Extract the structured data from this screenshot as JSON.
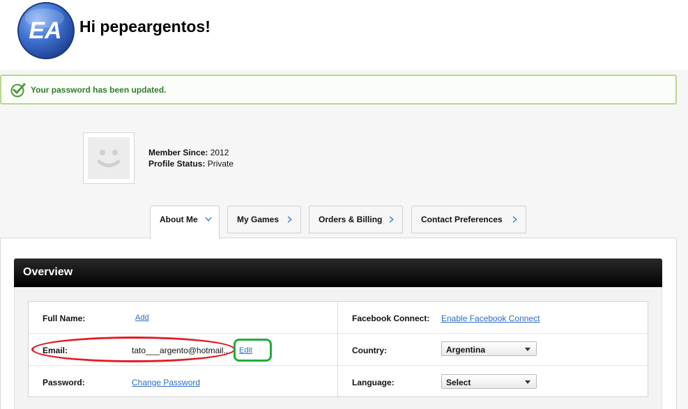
{
  "header": {
    "greeting": "Hi pepeargentos!",
    "logo_text": "EA"
  },
  "notice": {
    "message": "Your password has been updated.",
    "icon": "check-circle-icon",
    "color": "#2e7d32"
  },
  "profile": {
    "member_since_label": "Member Since:",
    "member_since_value": "2012",
    "profile_status_label": "Profile Status:",
    "profile_status_value": "Private"
  },
  "tabs": [
    {
      "label": "About Me",
      "icon": "chevron-down-icon",
      "active": true
    },
    {
      "label": "My Games",
      "icon": "chevron-right-icon"
    },
    {
      "label": "Orders & Billing",
      "icon": "chevron-right-icon"
    },
    {
      "label": "Contact Preferences",
      "icon": "chevron-right-icon"
    }
  ],
  "overview": {
    "title": "Overview",
    "rows": {
      "full_name": {
        "label": "Full Name:",
        "link": "Add"
      },
      "email": {
        "label": "Email:",
        "value": "tato___argento@hotmail...",
        "link": "Edit"
      },
      "password": {
        "label": "Password:",
        "link": "Change Password"
      },
      "facebook": {
        "label": "Facebook Connect:",
        "link": "Enable Facebook Connect"
      },
      "country": {
        "label": "Country:",
        "selected": "Argentina"
      },
      "language": {
        "label": "Language:",
        "selected": "Select"
      }
    }
  },
  "colors": {
    "accent": "#2b6bc4",
    "annotation_red": "#e31b23",
    "annotation_green": "#1fae3a"
  }
}
